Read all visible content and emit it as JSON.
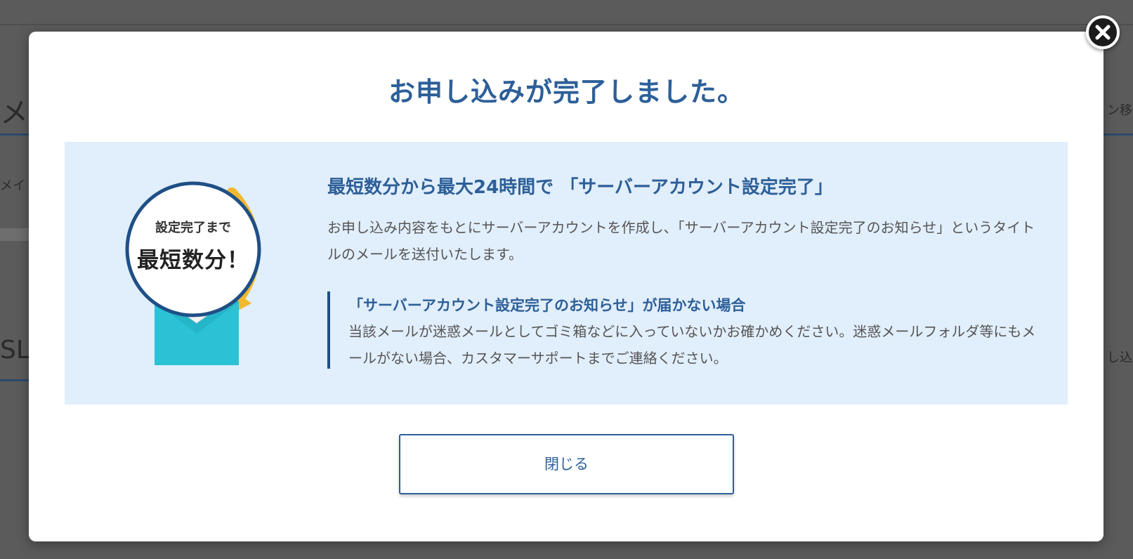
{
  "dialog": {
    "title": "お申し込みが完了しました。",
    "badge": {
      "line1": "設定完了まで",
      "line2": "最短数分！"
    },
    "heading": "最短数分から最大24時間で 「サーバーアカウント設定完了」",
    "body": "お申し込み内容をもとにサーバーアカウントを作成し、「サーバーアカウント設定完了のお知らせ」というタイトルのメールを送付いたします。",
    "note": {
      "title": "「サーバーアカウント設定完了のお知らせ」が届かない場合",
      "body": "当該メールが迷惑メールとしてゴミ箱などに入っていないかお確かめください。迷惑メールフォルダ等にもメールがない場合、カスタマーサポートまでご連絡ください。"
    },
    "close_button_label": "閉じる",
    "close_icon": "close-icon"
  },
  "background": {
    "fragment_left_1": "メ",
    "fragment_left_2": "メイ",
    "fragment_left_3": "SL",
    "fragment_right_1": "ン移",
    "fragment_right_2": "し込"
  },
  "colors": {
    "overlay": "#5b5b5b",
    "accent": "#2d5f98",
    "info_bg": "#e1eefb",
    "badge_blue": "#1f4f86",
    "badge_yellow": "#f2b82d",
    "envelope": "#25b5c8"
  }
}
